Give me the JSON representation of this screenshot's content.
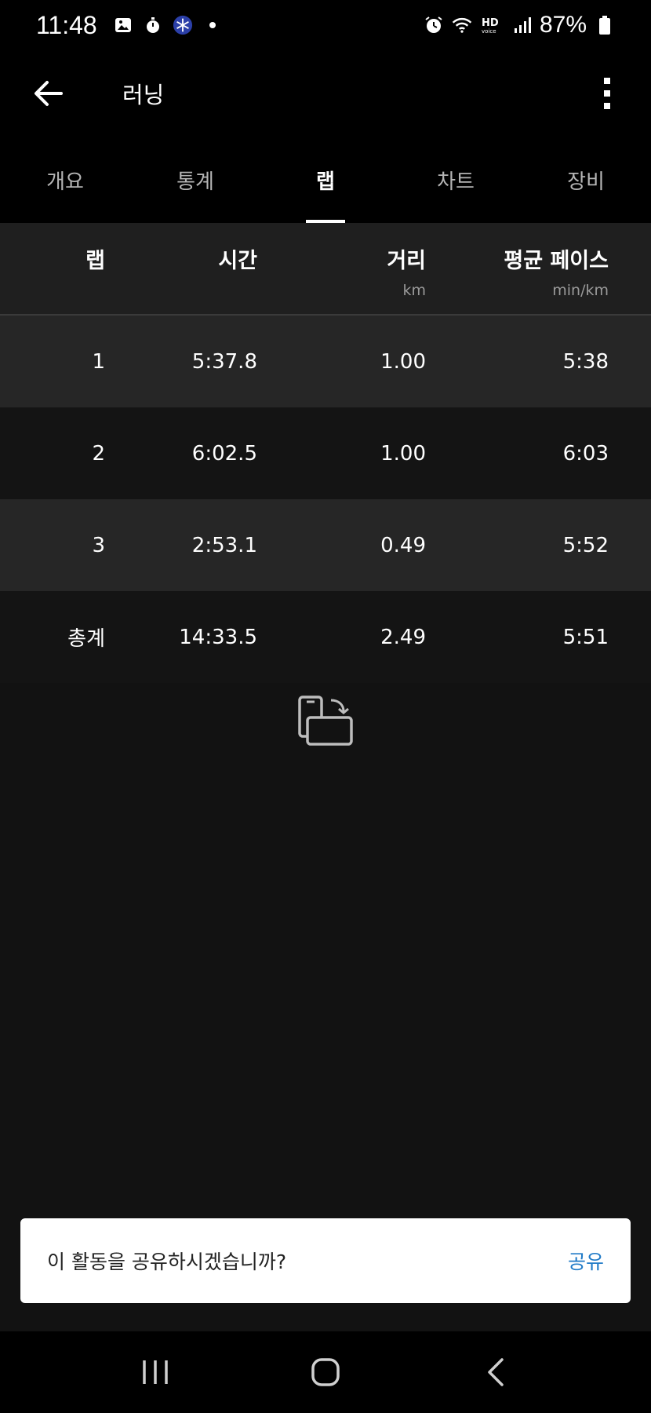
{
  "status_bar": {
    "time": "11:48",
    "battery": "87%",
    "left_icons": [
      "gallery-icon",
      "stopwatch-icon",
      "app-snowflake-icon",
      "dot-icon"
    ],
    "right_icons": [
      "alarm-icon",
      "wifi-icon",
      "hd-voice-icon",
      "signal-icon",
      "battery-icon"
    ]
  },
  "app_bar": {
    "title": "러닝"
  },
  "tabs": [
    {
      "label": "개요",
      "active": false
    },
    {
      "label": "통계",
      "active": false
    },
    {
      "label": "랩",
      "active": true
    },
    {
      "label": "차트",
      "active": false
    },
    {
      "label": "장비",
      "active": false
    }
  ],
  "table": {
    "columns": [
      {
        "title": "랩",
        "unit": ""
      },
      {
        "title": "시간",
        "unit": ""
      },
      {
        "title": "거리",
        "unit": "km"
      },
      {
        "title": "평균 페이스",
        "unit": "min/km"
      }
    ],
    "rows": [
      {
        "lap": "1",
        "time": "5:37.8",
        "distance": "1.00",
        "pace": "5:38"
      },
      {
        "lap": "2",
        "time": "6:02.5",
        "distance": "1.00",
        "pace": "6:03"
      },
      {
        "lap": "3",
        "time": "2:53.1",
        "distance": "0.49",
        "pace": "5:52"
      }
    ],
    "total": {
      "lap": "총계",
      "time": "14:33.5",
      "distance": "2.49",
      "pace": "5:51"
    }
  },
  "share": {
    "text": "이 활동을 공유하시겠습니까?",
    "button": "공유"
  },
  "colors": {
    "accent": "#1f7ac7",
    "background": "#121212",
    "row_alt": "#262626"
  }
}
